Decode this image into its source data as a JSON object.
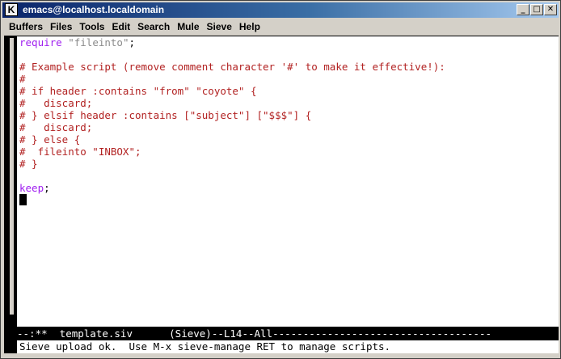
{
  "window": {
    "title": "emacs@localhost.localdomain",
    "icon_letter": "K",
    "controls": [
      "_",
      "□",
      "✕"
    ]
  },
  "menubar": {
    "items": [
      "Buffers",
      "Files",
      "Tools",
      "Edit",
      "Search",
      "Mule",
      "Sieve",
      "Help"
    ]
  },
  "buffer": {
    "lines": [
      [
        {
          "t": "require",
          "c": "kw"
        },
        {
          "t": " ",
          "c": "pl"
        },
        {
          "t": "\"fileinto\"",
          "c": "str"
        },
        {
          "t": ";",
          "c": "pl"
        }
      ],
      [],
      [
        {
          "t": "# Example script (remove comment character '#' to make it effective!):",
          "c": "cmt"
        }
      ],
      [
        {
          "t": "#",
          "c": "cmt"
        }
      ],
      [
        {
          "t": "# if header :contains \"from\" \"coyote\" {",
          "c": "cmt"
        }
      ],
      [
        {
          "t": "#   discard;",
          "c": "cmt"
        }
      ],
      [
        {
          "t": "# } elsif header :contains [\"subject\"] [\"$$$\"] {",
          "c": "cmt"
        }
      ],
      [
        {
          "t": "#   discard;",
          "c": "cmt"
        }
      ],
      [
        {
          "t": "# } else {",
          "c": "cmt"
        }
      ],
      [
        {
          "t": "#  fileinto \"INBOX\";",
          "c": "cmt"
        }
      ],
      [
        {
          "t": "# }",
          "c": "cmt"
        }
      ],
      [],
      [
        {
          "t": "keep",
          "c": "kw"
        },
        {
          "t": ";",
          "c": "pl"
        }
      ],
      [
        {
          "t": "",
          "c": "cursor"
        }
      ]
    ]
  },
  "modeline": {
    "text": "--:**  template.siv      (Sieve)--L14--All------------------------------------"
  },
  "minibuffer": {
    "message": "Sieve upload ok.  Use M-x sieve-manage RET to manage scripts."
  }
}
